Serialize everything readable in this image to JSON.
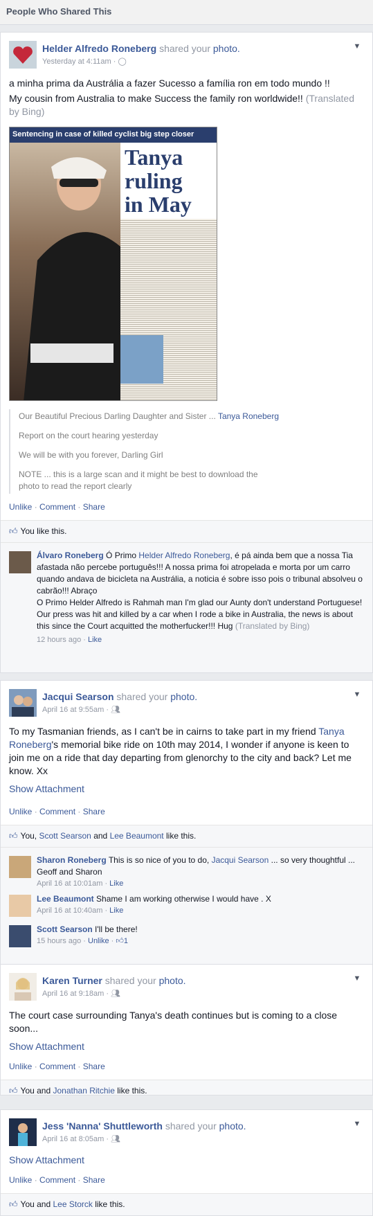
{
  "page": {
    "title": "People Who Shared This"
  },
  "posts": [
    {
      "author": "Helder Alfredo Roneberg",
      "shared_text": "shared your",
      "shared_obj": "photo.",
      "time": "Yesterday at 4:11am",
      "dot": "·",
      "line1": "a minha prima da Austrália a fazer Sucesso a família ron em todo mundo !!",
      "line2": "My cousin from Australia to make Success the family ron worldwide!!",
      "translated": "(Translated by Bing)",
      "newspaper": {
        "headline": "Sentencing in case of killed cyclist big step closer",
        "big1": "Tanya",
        "big2": "ruling",
        "big3": "in May"
      },
      "quote": {
        "q1": "Our Beautiful Precious Darling Daughter and Sister ...",
        "q1_link": "Tanya Roneberg",
        "q2": "Report on the court hearing yesterday",
        "q3": "We will be with you forever, Darling Girl",
        "q4": "NOTE ... this is a large scan and it might be best to download the photo to read the report clearly"
      },
      "actions": {
        "unlike": "Unlike",
        "comment": "Comment",
        "share": "Share",
        "sep": "·"
      },
      "likes": "You like this.",
      "comments": [
        {
          "name": "Álvaro Roneberg",
          "pre": "Ó Primo",
          "mention": "Helder Alfredo Roneberg",
          "text": ", é pá ainda bem que a nossa Tia afastada não percebe português!!! A nossa prima foi atropelada e morta por um carro quando andava de bicicleta na Austrália, a noticia é sobre isso pois o tribunal absolveu o cabrão!!! Abraço",
          "translation": "O Primo Helder Alfredo is Rahmah man I'm glad our Aunty don't understand Portuguese! Our press was hit and killed by a car when I rode a bike in Australia, the news is about this since the Court acquitted the motherfucker!!! Hug",
          "translated": "(Translated by Bing)",
          "time": "12 hours ago",
          "like": "Like"
        }
      ]
    },
    {
      "author": "Jacqui Searson",
      "shared_text": "shared your",
      "shared_obj": "photo.",
      "time": "April 16 at 9:55am",
      "text_a": "To my Tasmanian friends, as I can't be in cairns to take part in my friend",
      "text_link": "Tanya Roneberg",
      "text_b": "'s memorial bike ride on 10th may 2014, I wonder if anyone is keen to join me on a ride that day departing from glenorchy to the city and back? Let me know. Xx",
      "show_attachment": "Show Attachment",
      "likes_pre": "You,",
      "likes_a": "Scott Searson",
      "likes_and": "and",
      "likes_b": "Lee Beaumont",
      "likes_post": "like this.",
      "comments": [
        {
          "name": "Sharon Roneberg",
          "text_a": "This is so nice of you to do,",
          "mention": "Jacqui Searson",
          "text_b": "... so very thoughtful ... Geoff and Sharon",
          "time": "April 16 at 10:01am",
          "like": "Like"
        },
        {
          "name": "Lee Beaumont",
          "text_a": "Shame I am working otherwise I would have . X",
          "time": "April 16 at 10:40am",
          "like": "Like"
        },
        {
          "name": "Scott Searson",
          "text_a": "I'll be there!",
          "time": "15 hours ago",
          "like": "Unlike",
          "count": "1"
        }
      ]
    },
    {
      "author": "Karen Turner",
      "shared_text": "shared your",
      "shared_obj": "photo.",
      "time": "April 16 at 9:18am",
      "text": "The court case surrounding Tanya's death continues but is coming to a close soon...",
      "show_attachment": "Show Attachment",
      "likes_pre": "You and",
      "likes_a": "Jonathan Ritchie",
      "likes_post": "like this."
    },
    {
      "author": "Jess 'Nanna' Shuttleworth",
      "shared_text": "shared your",
      "shared_obj": "photo.",
      "time": "April 16 at 8:05am",
      "show_attachment": "Show Attachment",
      "likes_pre": "You and",
      "likes_a": "Lee Storck",
      "likes_post": "like this."
    }
  ],
  "colors": {
    "link": "#3b5998",
    "muted": "#9197a3",
    "bg": "#e9ebee"
  },
  "icons": {
    "chevron": "chevron-down-icon",
    "globe": "globe-icon",
    "friends": "friends-icon",
    "thumb": "thumbs-up-icon"
  }
}
